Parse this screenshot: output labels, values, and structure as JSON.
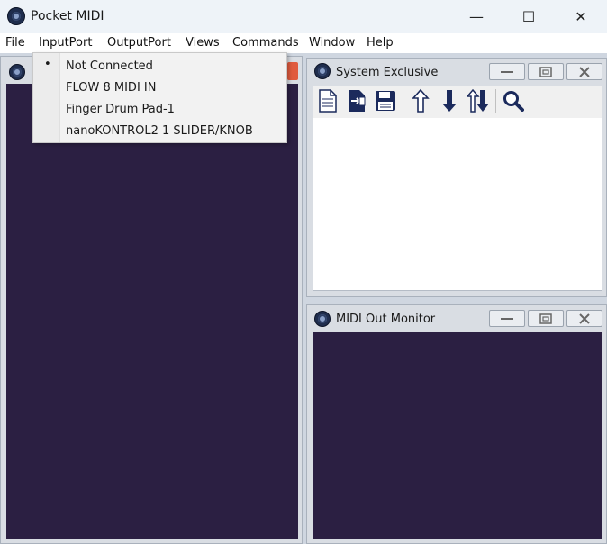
{
  "window": {
    "title": "Pocket MIDI",
    "minimize_glyph": "—",
    "maximize_glyph": "☐",
    "close_glyph": "✕"
  },
  "menubar": {
    "items": [
      "File",
      "InputPort",
      "OutputPort",
      "Views",
      "Commands",
      "Window",
      "Help"
    ]
  },
  "input_port_menu": {
    "selected_index": 0,
    "bullet": "•",
    "items": [
      "Not Connected",
      "FLOW 8 MIDI IN",
      "Finger Drum Pad-1",
      "nanoKONTROL2 1 SLIDER/KNOB"
    ]
  },
  "child_windows": {
    "sysex": {
      "title": "System Exclusive",
      "toolbar_icons": [
        "new-document-icon",
        "open-file-icon",
        "save-icon",
        "send-up-arrow-icon",
        "receive-down-arrow-icon",
        "send-receive-arrows-icon",
        "search-icon"
      ]
    },
    "monitor": {
      "title": "MIDI Out Monitor"
    }
  },
  "colors": {
    "monitor_background": "#2b1f42",
    "titlebar": "#eef3f8",
    "icon_blue": "#1b2a5c"
  }
}
